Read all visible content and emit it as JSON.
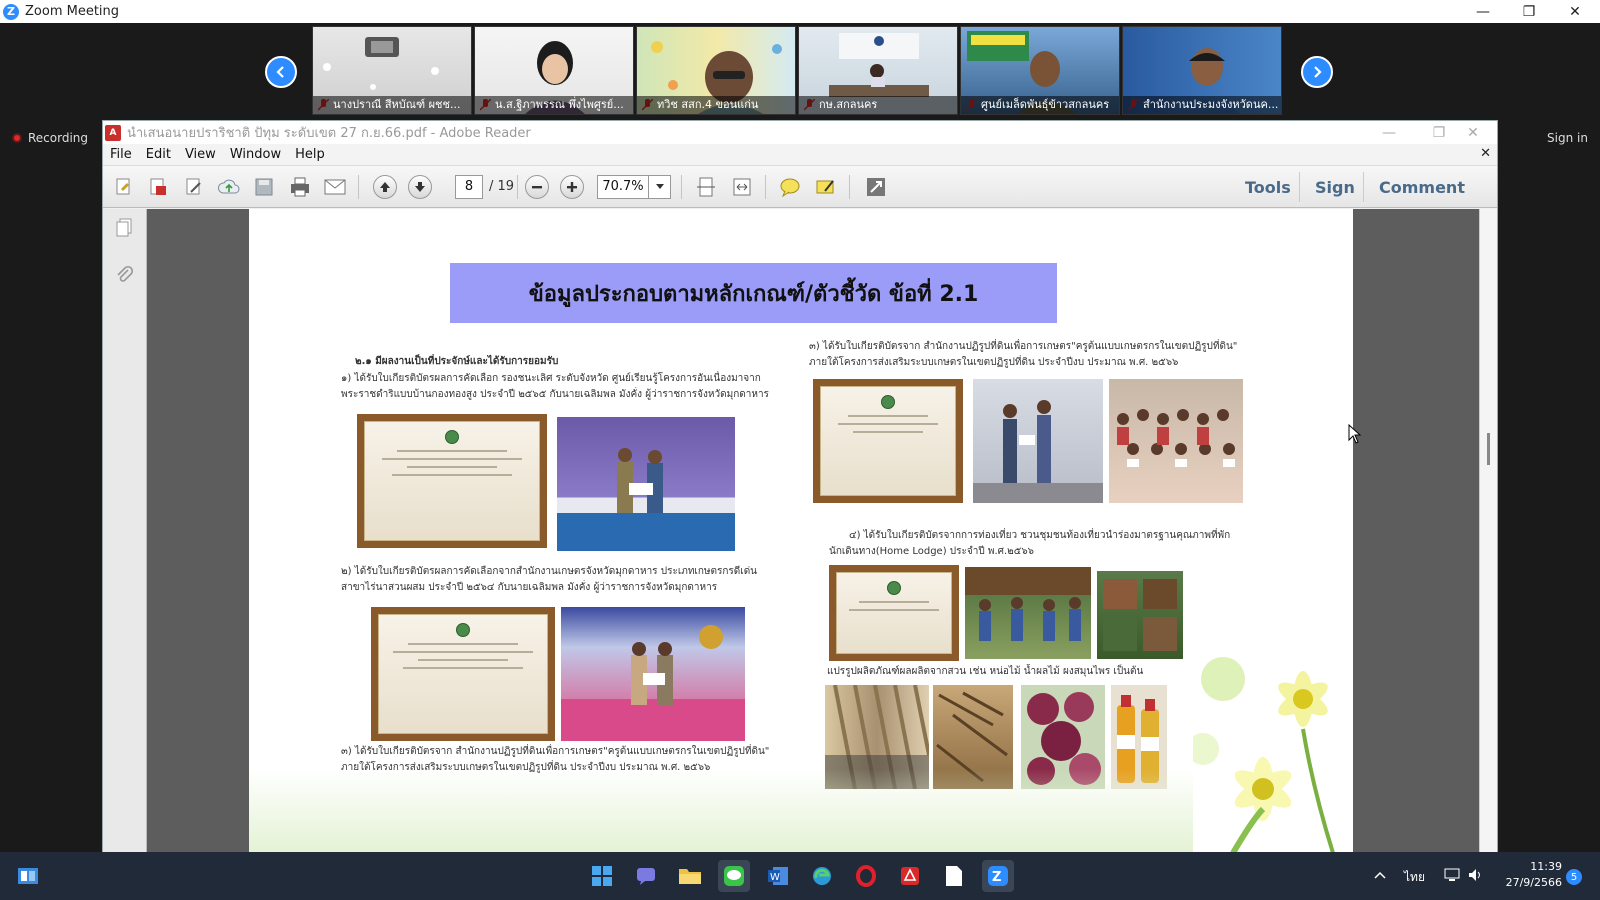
{
  "zoom": {
    "title": "Zoom Meeting",
    "logo_letter": "Z",
    "recording_label": "Recording",
    "sign_in_label": "Sign in",
    "window_controls": {
      "minimize": "—",
      "maximize": "❐",
      "close": "✕"
    },
    "participants": [
      {
        "name": "นางปราณี สีหบัณฑ์ ผชช..."
      },
      {
        "name": "น.ส.ฐิภาพรรณ พึ่งไพศูรย์..."
      },
      {
        "name": "ทวิช สสก.4 ขอนแก่น"
      },
      {
        "name": "กษ.สกลนคร"
      },
      {
        "name": "ศูนย์เมล็ดพันธุ์ข้าวสกลนคร"
      },
      {
        "name": "สำนักงานประมงจังหวัดนค..."
      }
    ]
  },
  "adobe": {
    "title": "นำเสนอนายปราริชาติ ปัทุม ระดับเขต 27 ก.ย.66.pdf - Adobe Reader",
    "menu": [
      "File",
      "Edit",
      "View",
      "Window",
      "Help"
    ],
    "menu_close": "✕",
    "current_page": "8",
    "page_total": "/ 19",
    "zoom_level": "70.7%",
    "right_tools": {
      "tools": "Tools",
      "sign": "Sign",
      "comment": "Comment"
    }
  },
  "pdf": {
    "heading": "ข้อมูลประกอบตามหลักเกณฑ์/ตัวชี้วัด ข้อที่ 2.1",
    "section_title": "๒.๑ มีผลงานเป็นที่ประจักษ์และได้รับการยอมรับ",
    "item1_line1": "๑) ได้รับใบเกียรติบัตรผลการคัดเลือก รองชนะเลิศ ระดับจังหวัด ศูนย์เรียนรู้โครงการอันเนื่องมาจาก",
    "item1_line2": "พระราชดำริแบบบ้านกองทองสูง ประจำปี ๒๕๖๕ กับนายเฉลิมพล มังคั่ง ผู้ว่าราชการจังหวัดมุกดาหาร",
    "item2_line1": "๒) ได้รับใบเกียรติบัตรผลการคัดเลือกจากสำนักงานเกษตรจังหวัดมุกดาหาร ประเภทเกษตรกรดีเด่น",
    "item2_line2": "สาขาไร่นาสวนผสม ประจำปี ๒๕๖๔ กับนายเฉลิมพล มังคั่ง ผู้ว่าราชการจังหวัดมุกดาหาร",
    "item3_line1": "๓) ได้รับใบเกียรติบัตรจาก สำนักงานปฏิรูปที่ดินเพื่อการเกษตร\"ครูต้นแบบเกษตรกรในเขตปฏิรูปที่ดิน\"",
    "item3_line2": "ภายใต้โครงการส่งเสริมระบบเกษตรในเขตปฏิรูปที่ดิน ประจำปีงบ ประมาณ พ.ศ. ๒๕๖๖",
    "right1_line1": "๓) ได้รับใบเกียรติบัตรจาก สำนักงานปฏิรูปที่ดินเพื่อการเกษตร\"ครูต้นแบบเกษตรกรในเขตปฏิรูปที่ดิน\"",
    "right1_line2": "ภายใต้โครงการส่งเสริมระบบเกษตรในเขตปฏิรูปที่ดิน ประจำปีงบ ประมาณ พ.ศ. ๒๕๖๖",
    "right2_line1": "๔) ได้รับใบเกียรติบัตรจากการท่องเที่ยว ชวนชุมชนท้องเที่ยวนำร่องมาตรฐานคุณภาพที่พัก",
    "right2_line2": "นักเดินทาง(Home Lodge) ประจำปี พ.ศ.๒๕๖๖",
    "right3_line1": "แปรรูปผลิตภัณฑ์ผลผลิตจากสวน เช่น หน่อไม้ น้ำผลไม้ ผงสมุนไพร เป็นต้น"
  },
  "taskbar": {
    "language": "ไทย",
    "time": "11:39",
    "date": "27/9/2566",
    "notifications": "5",
    "apps": [
      "start",
      "search",
      "teams",
      "file-explorer",
      "line",
      "word",
      "edge",
      "opera",
      "acrobat",
      "notes",
      "zoom"
    ]
  },
  "colors": {
    "zoom_blue": "#2d8cff",
    "heading_bg": "#9b9bf8",
    "toolbar_text": "#4a6a8a",
    "taskbar": "#202a38"
  }
}
